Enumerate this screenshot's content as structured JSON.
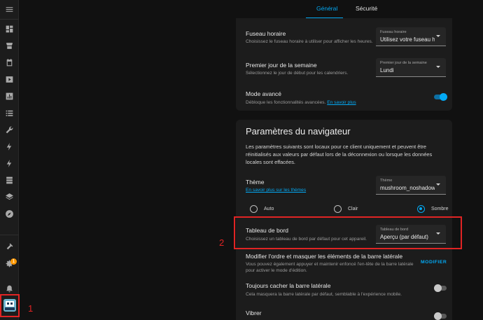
{
  "tabs": [
    {
      "label": "Général",
      "active": true
    },
    {
      "label": "Sécurité",
      "active": false
    }
  ],
  "general": {
    "timezone": {
      "title": "Fuseau horaire",
      "description": "Choisissez le fuseau horaire à utiliser pour afficher les heures.",
      "select_label": "Fuseau horaire",
      "select_value": "Utilisez votre fuseau h"
    },
    "first_day": {
      "title": "Premier jour de la semaine",
      "description": "Sélectionnez le jour de début pour les calendriers.",
      "select_label": "Premier jour de la semaine",
      "select_value": "Lundi"
    },
    "advanced": {
      "title": "Mode avancé",
      "description": "Débloque les fonctionnalités avancées.",
      "link": "En savoir plus",
      "enabled": true
    }
  },
  "browser": {
    "heading": "Paramètres du navigateur",
    "intro": "Les paramètres suivants sont locaux pour ce client uniquement et peuvent être réinitialisés aux valeurs par défaut lors de la déconnexion ou lorsque les données locales sont effacées.",
    "theme": {
      "title": "Thème",
      "link": "En savoir plus sur les thèmes",
      "select_label": "Thème",
      "select_value": "mushroom_noshadow"
    },
    "mode_options": [
      {
        "label": "Auto",
        "checked": false
      },
      {
        "label": "Clair",
        "checked": false
      },
      {
        "label": "Sombre",
        "checked": true
      }
    ],
    "dashboard": {
      "title": "Tableau de bord",
      "description": "Choisissez un tableau de bord par défaut pour cet appareil.",
      "select_label": "Tableau de bord",
      "select_value": "Aperçu (par défaut)"
    },
    "sidebar_edit": {
      "title": "Modifier l'ordre et masquer les éléments de la barre latérale",
      "description": "Vous pouvez également appuyer et maintenir enfoncé l'en-tête de la barre latérale pour activer le mode d'édition.",
      "button": "MODIFIER"
    },
    "hide_sidebar": {
      "title": "Toujours cacher la barre latérale",
      "description": "Cela masquera la barre latérale par défaut, semblable à l'expérience mobile.",
      "enabled": false
    },
    "vibrate": {
      "title": "Vibrer",
      "enabled": false
    }
  },
  "sidebar": {
    "notification_count": "1"
  },
  "annotations": {
    "one": "1",
    "two": "2"
  },
  "colors": {
    "accent": "#03a9f4",
    "annotation": "#e02424",
    "badge": "#ff9800"
  }
}
